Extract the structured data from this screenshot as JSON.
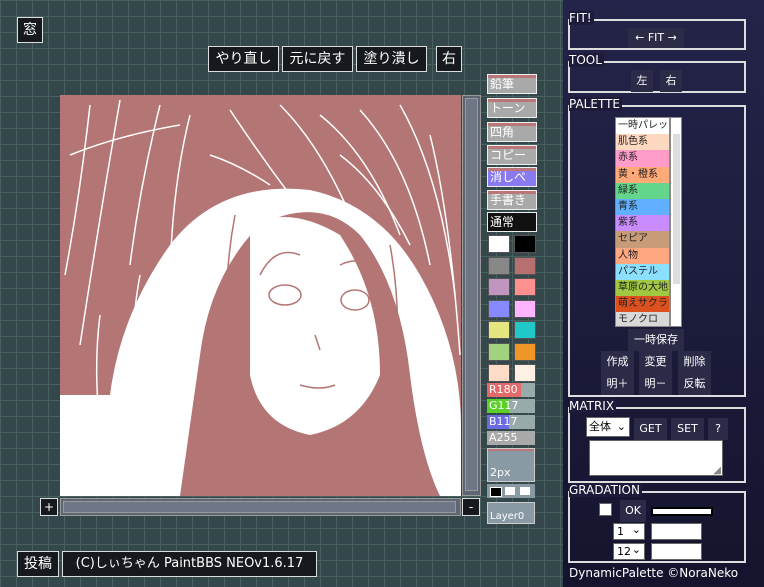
{
  "top": {
    "window_button": "窓",
    "redo": "やり直し",
    "undo": "元に戻す",
    "fill": "塗り潰し",
    "right": "右"
  },
  "tools": [
    "鉛筆",
    "トーン",
    "四角",
    "コピー",
    "消しペン",
    "手書き",
    "通常"
  ],
  "colors": [
    "#ffffff",
    "#000000",
    "#888888",
    "#b77070",
    "#c096c0",
    "#ff9090",
    "#8888ff",
    "#ffb4ff",
    "#e6e680",
    "#20c8c8",
    "#a0d280",
    "#f09628",
    "#ffdcc8",
    "#fff0e6"
  ],
  "sliders": [
    {
      "label": "R180",
      "value": 180,
      "color": "#e46a6a"
    },
    {
      "label": "G117",
      "value": 117,
      "color": "#5ccf28"
    },
    {
      "label": "B117",
      "value": 117,
      "color": "#6a6ae4"
    },
    {
      "label": "A255",
      "value": 255,
      "color": "#a9a9a9"
    }
  ],
  "pen_size": "2px",
  "layer": "Layer0",
  "canvas": {
    "plus": "+",
    "minus": "-"
  },
  "footer": {
    "post": "投稿",
    "credit": "(C)しぃちゃん PaintBBS NEOv1.6.17"
  },
  "panels": {
    "fit": {
      "title": "FIT!",
      "button": "← FIT →"
    },
    "tool": {
      "title": "TOOL",
      "left": "左",
      "right": "右"
    },
    "palette": {
      "title": "PALETTE",
      "items": [
        {
          "label": "一時パレット",
          "color": "#ffffff"
        },
        {
          "label": "肌色系",
          "color": "#ffd8c0"
        },
        {
          "label": "赤系",
          "color": "#ff9cc8"
        },
        {
          "label": "黄・橙系",
          "color": "#ffa878"
        },
        {
          "label": "緑系",
          "color": "#64d68c"
        },
        {
          "label": "青系",
          "color": "#60b0ff"
        },
        {
          "label": "紫系",
          "color": "#c88cff"
        },
        {
          "label": "セピア",
          "color": "#c89c78"
        },
        {
          "label": "人物",
          "color": "#ffa880"
        },
        {
          "label": "パステル",
          "color": "#8ce0ff"
        },
        {
          "label": "草原の大地",
          "color": "#a0c840"
        },
        {
          "label": "萌えサクラ",
          "color": "#dc5020"
        },
        {
          "label": "モノクロ",
          "color": "#d8d8d8"
        }
      ],
      "temp_save": "一時保存",
      "create": "作成",
      "change": "変更",
      "delete": "削除",
      "brighter": "明＋",
      "darker": "明－",
      "invert": "反転"
    },
    "matrix": {
      "title": "MATRIX",
      "select": "全体",
      "get": "GET",
      "set": "SET",
      "help": "?"
    },
    "gradation": {
      "title": "GRADATION",
      "ok": "OK",
      "sel1": "1",
      "sel2": "12"
    }
  },
  "credit_right": "DynamicPalette ©NoraNeko"
}
